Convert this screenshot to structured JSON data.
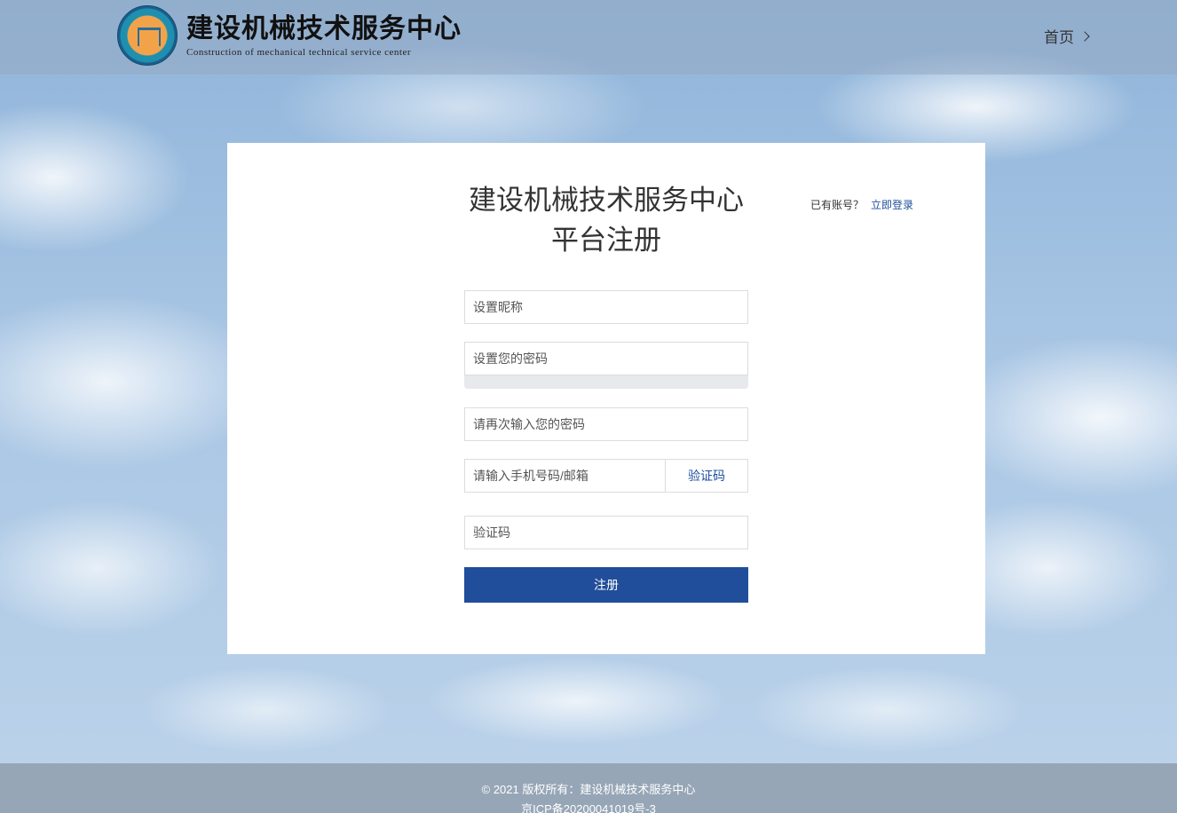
{
  "header": {
    "logo_title": "建设机械技术服务中心",
    "logo_subtitle": "Construction of mechanical technical service center",
    "nav_home": "首页"
  },
  "card": {
    "title_line1": "建设机械技术服务中心",
    "title_line2": "平台注册",
    "login_prompt": "已有账号？",
    "login_link": "立即登录"
  },
  "form": {
    "nickname_placeholder": "设置昵称",
    "password_placeholder": "设置您的密码",
    "confirm_password_placeholder": "请再次输入您的密码",
    "phone_email_placeholder": "请输入手机号码/邮箱",
    "get_code_button": "验证码",
    "code_placeholder": "验证码",
    "submit_button": "注册"
  },
  "footer": {
    "copyright": "© 2021 版权所有：建设机械技术服务中心",
    "icp": "京ICP备20200041019号-3"
  },
  "colors": {
    "primary": "#214e9a",
    "link": "#1f4f9c"
  }
}
